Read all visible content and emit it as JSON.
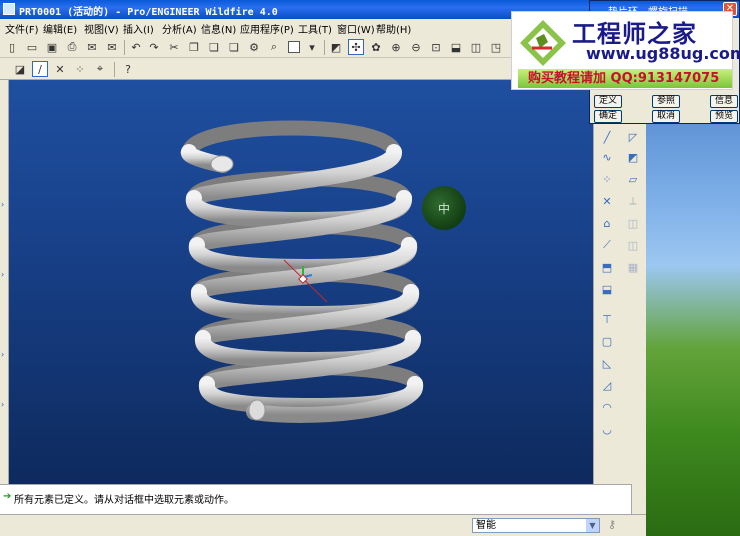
{
  "window": {
    "title": "PRT0001 (活动的) - Pro/ENGINEER Wildfire 4.0"
  },
  "menu": [
    "文件(F)",
    "编辑(E)",
    "视图(V)",
    "插入(I)",
    "分析(A)",
    "信息(N)",
    "应用程序(P)",
    "工具(T)",
    "窗口(W)",
    "帮助(H)"
  ],
  "dashboard": {
    "title": "垫片环 - 螺旋扫描",
    "buttons": {
      "define": "定义",
      "refs": "参照",
      "info": "信息",
      "ok": "确定",
      "cancel": "取消",
      "preview": "预览"
    }
  },
  "watermark": {
    "title": "工程师之家",
    "url": "www.ug88ug.com",
    "contact": "购买教程请加 QQ:913147075"
  },
  "viewport": {
    "model": "helical spring",
    "background_top": "#1f4fa0",
    "background_bottom": "#0e2a5e",
    "spring_color": "#cfcfcf",
    "spin_center_label": "中"
  },
  "message": {
    "text": "所有元素已定义。请从对话框中选取元素或动作。"
  },
  "status": {
    "filter": "智能"
  },
  "icons": {
    "toolbar1": [
      "new-icon",
      "open-icon",
      "save-icon",
      "print-icon",
      "email-icon",
      "undo-icon",
      "redo-icon",
      "cut-icon",
      "copy-icon",
      "paste-icon",
      "regenerate-icon",
      "find-icon",
      "select-box-icon",
      "sketch-icon",
      "datum-icon",
      "repaint-icon",
      "zoom-in-icon",
      "zoom-out-icon",
      "refit-icon",
      "orient-icon"
    ],
    "toolbar2": [
      "layer-icon",
      "datum-plane-icon",
      "datum-axis-icon",
      "datum-point-icon",
      "csys-icon",
      "help-icon"
    ]
  }
}
